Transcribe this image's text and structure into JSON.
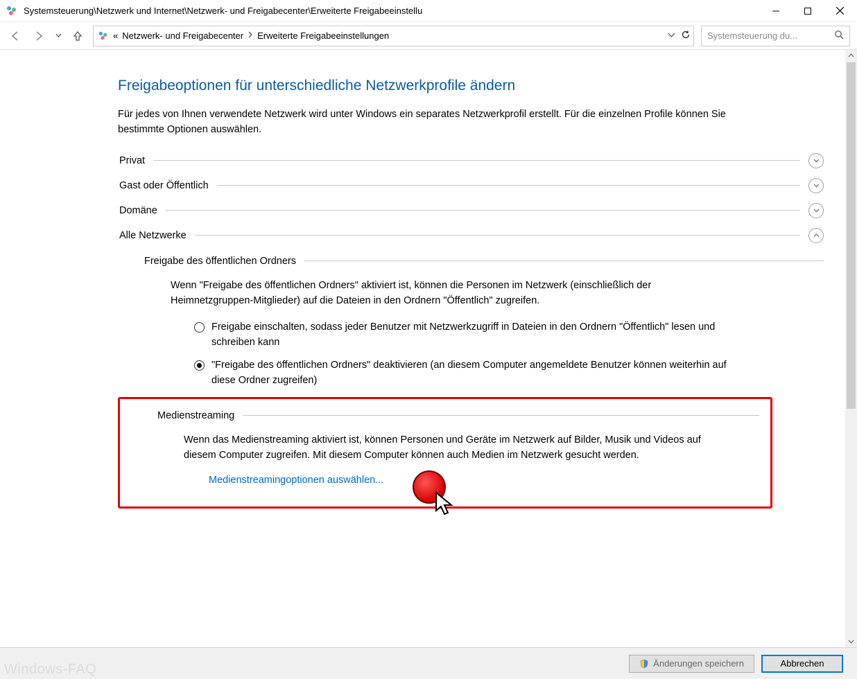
{
  "window": {
    "title": "Systemsteuerung\\Netzwerk und Internet\\Netzwerk- und Freigabecenter\\Erweiterte Freigabeeinstellu"
  },
  "breadcrumb": {
    "ellipsis": "«",
    "item1": "Netzwerk- und Freigabecenter",
    "item2": "Erweiterte Freigabeeinstellungen"
  },
  "search": {
    "placeholder": "Systemsteuerung du..."
  },
  "page": {
    "title": "Freigabeoptionen für unterschiedliche Netzwerkprofile ändern",
    "intro": "Für jedes von Ihnen verwendete Netzwerk wird unter Windows ein separates Netzwerkprofil erstellt. Für die einzelnen Profile können Sie bestimmte Optionen auswählen."
  },
  "profiles": {
    "privat": "Privat",
    "gast": "Gast oder Öffentlich",
    "domaene": "Domäne",
    "alle": "Alle Netzwerke"
  },
  "publicFolder": {
    "heading": "Freigabe des öffentlichen Ordners",
    "desc": "Wenn \"Freigabe des öffentlichen Ordners\" aktiviert ist, können die Personen im Netzwerk (einschließlich der Heimnetzgruppen-Mitglieder) auf die Dateien in den Ordnern \"Öffentlich\" zugreifen.",
    "radio1": "Freigabe einschalten, sodass jeder Benutzer mit Netzwerkzugriff in Dateien in den Ordnern \"Öffentlich\" lesen und schreiben kann",
    "radio2": "\"Freigabe des öffentlichen Ordners\" deaktivieren (an diesem Computer angemeldete Benutzer können weiterhin auf diese Ordner zugreifen)"
  },
  "mediaStreaming": {
    "heading": "Medienstreaming",
    "desc": "Wenn das Medienstreaming aktiviert ist, können Personen und Geräte im Netzwerk auf Bilder, Musik und Videos auf diesem Computer zugreifen. Mit diesem Computer können auch Medien im Netzwerk gesucht werden.",
    "link": "Medienstreamingoptionen auswählen..."
  },
  "footer": {
    "save": "Änderungen speichern",
    "cancel": "Abbrechen",
    "watermark": "Windows-FAQ"
  }
}
